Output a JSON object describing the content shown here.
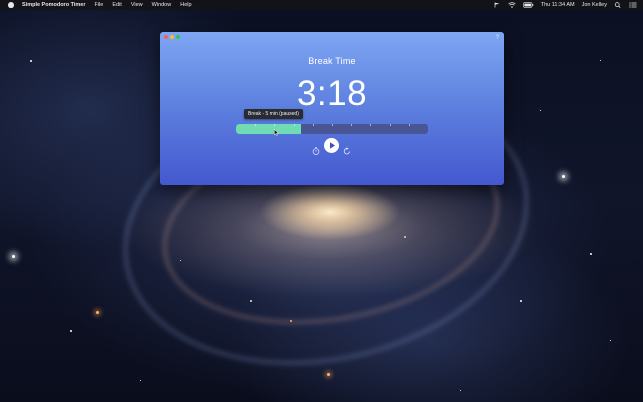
{
  "menubar": {
    "app_name": "Simple Pomodoro Timer",
    "menus": [
      "File",
      "Edit",
      "View",
      "Window",
      "Help"
    ],
    "clock": "Thu 11:34 AM",
    "user": "Jon Kelley"
  },
  "timer_window": {
    "help_label": "?",
    "session_title": "Break Time",
    "time_remaining": "3:18",
    "tooltip": "Break - 5 min (paused)",
    "progress_fraction": 0.34,
    "progress_tick_count": 9,
    "colors": {
      "gradient_top": "#7ea6f2",
      "gradient_bottom": "#4458cf",
      "progress_fill": "#6fdcb4",
      "progress_track": "#4a5596"
    }
  },
  "icons": {
    "menubar_right": [
      "flag-icon",
      "wifi-icon",
      "battery-icon",
      "search-icon",
      "notification-list-icon"
    ],
    "controls": [
      "stopwatch-icon",
      "play-icon",
      "reset-icon"
    ]
  }
}
